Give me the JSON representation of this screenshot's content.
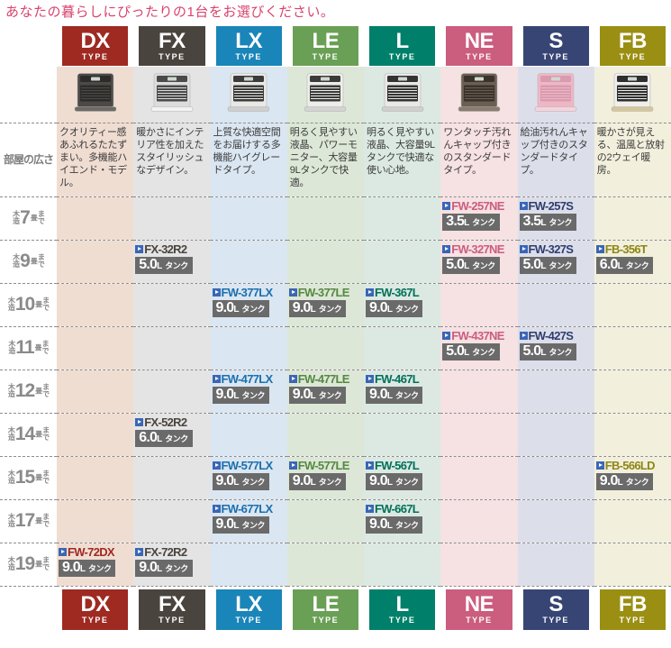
{
  "title": "あなたの暮らしにぴったりの1台をお選びください。",
  "title_color": "#d9436d",
  "row_header_label": "部屋の広さ",
  "tank_unit_label": "L",
  "tank_suffix_label": "タンク",
  "size_prefix_label": "木造",
  "size_unit_label": "畳",
  "size_suffix_label": "まで",
  "columns": [
    {
      "code": "DX",
      "type_label": "TYPE",
      "badge_color": "#9e2a22",
      "tint": "#f0ddd2",
      "text_color": "#9e2a22",
      "description": "クオリティー感あふれるたたずまい。多機能ハイエンド・モデル。",
      "photo_body": "#4c4946",
      "photo_panel": "#2e2c2a",
      "photo_base": "#6e6a66"
    },
    {
      "code": "FX",
      "type_label": "TYPE",
      "badge_color": "#4a443f",
      "tint": "#e4e4e4",
      "text_color": "#4a443f",
      "description": "暖かさにインテリア性を加えたスタイリッシュなデザイン。",
      "photo_body": "#dcdcdc",
      "photo_panel": "#4a4a4a",
      "photo_base": "#f2f2f2"
    },
    {
      "code": "LX",
      "type_label": "TYPE",
      "badge_color": "#1a85b8",
      "tint": "#dae6f1",
      "text_color": "#1a6fae",
      "description": "上質な快適空間をお届けする多機能ハイグレードタイプ。",
      "photo_body": "#e8e8e6",
      "photo_panel": "#3b3b3b",
      "photo_base": "#cfcfcf"
    },
    {
      "code": "LE",
      "type_label": "TYPE",
      "badge_color": "#6aa055",
      "tint": "#dde7d7",
      "text_color": "#55893f",
      "description": "明るく見やすい液晶、パワーモニター、大容量9Lタンクで快適。",
      "photo_body": "#ededea",
      "photo_panel": "#3b3b3b",
      "photo_base": "#d4d4d4"
    },
    {
      "code": "L",
      "type_label": "TYPE",
      "badge_color": "#00806a",
      "tint": "#dce9e3",
      "text_color": "#007058",
      "description": "明るく見やすい液晶、大容量9Lタンクで快適な使い心地。",
      "photo_body": "#e9e9e7",
      "photo_panel": "#333333",
      "photo_base": "#cfcfcf"
    },
    {
      "code": "NE",
      "type_label": "TYPE",
      "badge_color": "#cb5d7e",
      "tint": "#f6e1e3",
      "text_color": "#cb5d7e",
      "description": "ワンタッチ汚れんキャップ付きのスタンダードタイプ。",
      "photo_body": "#6b5f53",
      "photo_panel": "#3a332c",
      "photo_base": "#8a7d70"
    },
    {
      "code": "S",
      "type_label": "TYPE",
      "badge_color": "#374575",
      "tint": "#dcdfea",
      "text_color": "#2e3d70",
      "description": "給油汚れんキャップ付きのスタンダードタイプ。",
      "photo_body": "#efb7c6",
      "photo_panel": "#d99bb0",
      "photo_base": "#f5d2dc"
    },
    {
      "code": "FB",
      "type_label": "TYPE",
      "badge_color": "#9a8f12",
      "tint": "#f2f0dd",
      "text_color": "#8e8616",
      "description": "暖かさが見える、温風と放射の2ウェイ暖房。",
      "photo_body": "#f0efec",
      "photo_panel": "#2e2e2e",
      "photo_base": "#d5c79a"
    }
  ],
  "rows": [
    {
      "size": "7",
      "cells": [
        null,
        null,
        null,
        null,
        null,
        {
          "model": "FW-257NE",
          "tank": "3.5"
        },
        {
          "model": "FW-257S",
          "tank": "3.5"
        },
        null
      ]
    },
    {
      "size": "9",
      "cells": [
        null,
        {
          "model": "FX-32R2",
          "tank": "5.0"
        },
        null,
        null,
        null,
        {
          "model": "FW-327NE",
          "tank": "5.0"
        },
        {
          "model": "FW-327S",
          "tank": "5.0"
        },
        {
          "model": "FB-356T",
          "tank": "6.0"
        }
      ]
    },
    {
      "size": "10",
      "cells": [
        null,
        null,
        {
          "model": "FW-377LX",
          "tank": "9.0"
        },
        {
          "model": "FW-377LE",
          "tank": "9.0"
        },
        {
          "model": "FW-367L",
          "tank": "9.0"
        },
        null,
        null,
        null
      ]
    },
    {
      "size": "11",
      "cells": [
        null,
        null,
        null,
        null,
        null,
        {
          "model": "FW-437NE",
          "tank": "5.0"
        },
        {
          "model": "FW-427S",
          "tank": "5.0"
        },
        null
      ]
    },
    {
      "size": "12",
      "cells": [
        null,
        null,
        {
          "model": "FW-477LX",
          "tank": "9.0"
        },
        {
          "model": "FW-477LE",
          "tank": "9.0"
        },
        {
          "model": "FW-467L",
          "tank": "9.0"
        },
        null,
        null,
        null
      ]
    },
    {
      "size": "14",
      "cells": [
        null,
        {
          "model": "FX-52R2",
          "tank": "6.0"
        },
        null,
        null,
        null,
        null,
        null,
        null
      ]
    },
    {
      "size": "15",
      "cells": [
        null,
        null,
        {
          "model": "FW-577LX",
          "tank": "9.0"
        },
        {
          "model": "FW-577LE",
          "tank": "9.0"
        },
        {
          "model": "FW-567L",
          "tank": "9.0"
        },
        null,
        null,
        {
          "model": "FB-566LD",
          "tank": "9.0"
        }
      ]
    },
    {
      "size": "17",
      "cells": [
        null,
        null,
        {
          "model": "FW-677LX",
          "tank": "9.0"
        },
        null,
        {
          "model": "FW-667L",
          "tank": "9.0"
        },
        null,
        null,
        null
      ]
    },
    {
      "size": "19",
      "cells": [
        {
          "model": "FW-72DX",
          "tank": "9.0"
        },
        {
          "model": "FX-72R2",
          "tank": "9.0"
        },
        null,
        null,
        null,
        null,
        null,
        null
      ]
    }
  ]
}
